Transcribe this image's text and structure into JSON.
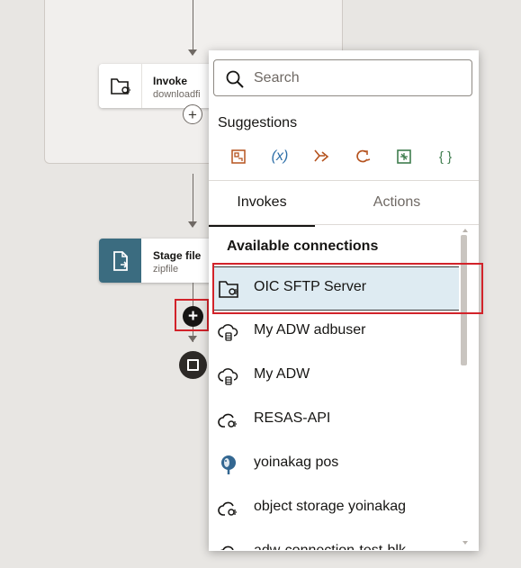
{
  "flow": {
    "invoke_node": {
      "title": "Invoke",
      "subtitle": "downloadfi"
    },
    "stage_node": {
      "title": "Stage file",
      "subtitle": "zipfile"
    }
  },
  "popup": {
    "search": {
      "placeholder": "Search",
      "value": ""
    },
    "suggestions_label": "Suggestions",
    "suggestion_icons": [
      {
        "name": "map-icon",
        "glyph": "▣",
        "color": "#b5531f"
      },
      {
        "name": "variable-icon",
        "glyph": "(x)",
        "color": "#2e6fa8"
      },
      {
        "name": "branch-icon",
        "glyph": "⤳",
        "color": "#b5531f"
      },
      {
        "name": "loop-icon",
        "glyph": "↻",
        "color": "#b5531f"
      },
      {
        "name": "scope-icon",
        "glyph": "⊞",
        "color": "#3f7d4e"
      },
      {
        "name": "code-icon",
        "glyph": "{ }",
        "color": "#3f7d4e"
      }
    ],
    "tabs": [
      "Invokes",
      "Actions"
    ],
    "active_tab": "Invokes",
    "section_title": "Available connections",
    "connections": [
      {
        "label": "OIC SFTP Server",
        "icon": "folder-connection-icon",
        "selected": true
      },
      {
        "label": "My ADW adbuser",
        "icon": "cloud-database-icon"
      },
      {
        "label": "My ADW",
        "icon": "cloud-database-icon"
      },
      {
        "label": "RESAS-API",
        "icon": "cloud-connection-icon"
      },
      {
        "label": "yoinakag pos",
        "icon": "postgres-icon"
      },
      {
        "label": "object storage yoinakag",
        "icon": "cloud-connection-icon"
      },
      {
        "label": "adw-connection-test-blk",
        "icon": "cloud-connection-icon"
      }
    ]
  }
}
